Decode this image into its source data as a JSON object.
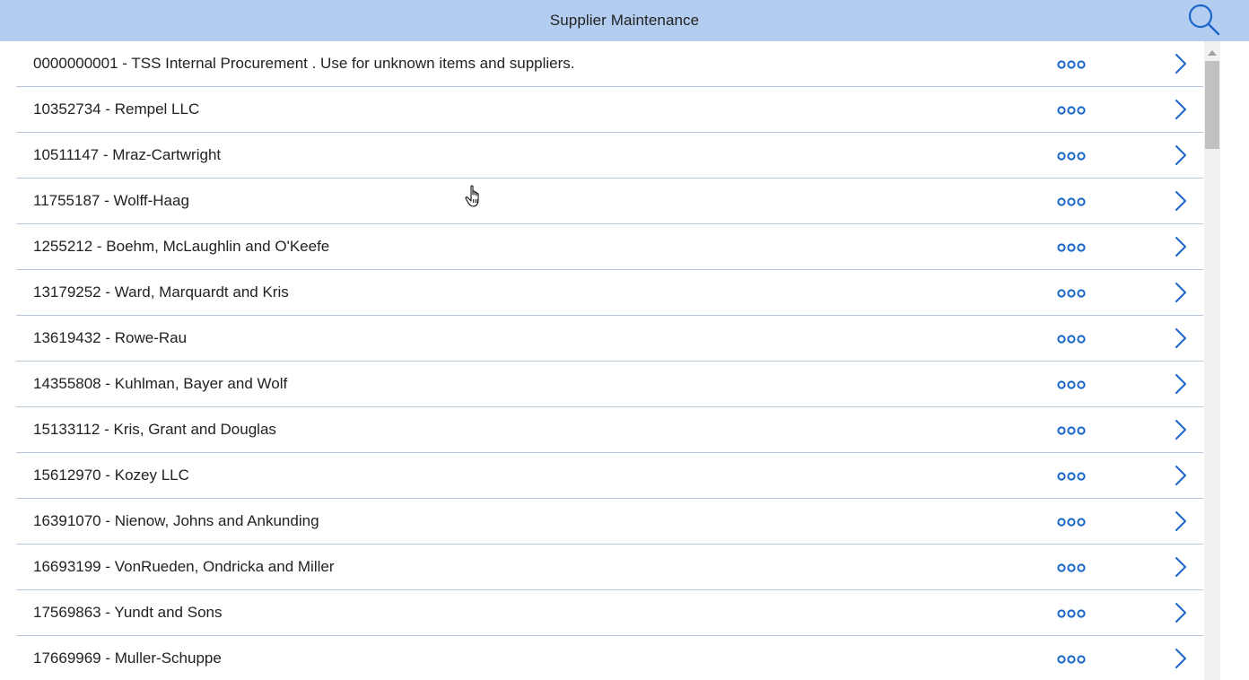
{
  "header": {
    "title": "Supplier Maintenance",
    "search_icon": "search-icon"
  },
  "colors": {
    "header_bg": "#b3cdf0",
    "accent": "#1a66c9",
    "divider": "#b8c8d8"
  },
  "suppliers": [
    {
      "text": "0000000001 - TSS Internal Procurement . Use for unknown items and suppliers."
    },
    {
      "text": "10352734 - Rempel LLC"
    },
    {
      "text": "10511147 - Mraz-Cartwright"
    },
    {
      "text": "11755187 - Wolff-Haag"
    },
    {
      "text": "1255212 - Boehm, McLaughlin and O'Keefe"
    },
    {
      "text": "13179252 - Ward, Marquardt and Kris"
    },
    {
      "text": "13619432 - Rowe-Rau"
    },
    {
      "text": "14355808 - Kuhlman, Bayer and Wolf"
    },
    {
      "text": "15133112 - Kris, Grant and Douglas"
    },
    {
      "text": "15612970 - Kozey LLC"
    },
    {
      "text": "16391070 - Nienow, Johns and Ankunding"
    },
    {
      "text": "16693199 - VonRueden, Ondricka and Miller"
    },
    {
      "text": "17569863 - Yundt and Sons"
    },
    {
      "text": "17669969 - Muller-Schuppe"
    }
  ],
  "row_icons": {
    "more": "more-options-icon",
    "open": "chevron-right-icon"
  }
}
